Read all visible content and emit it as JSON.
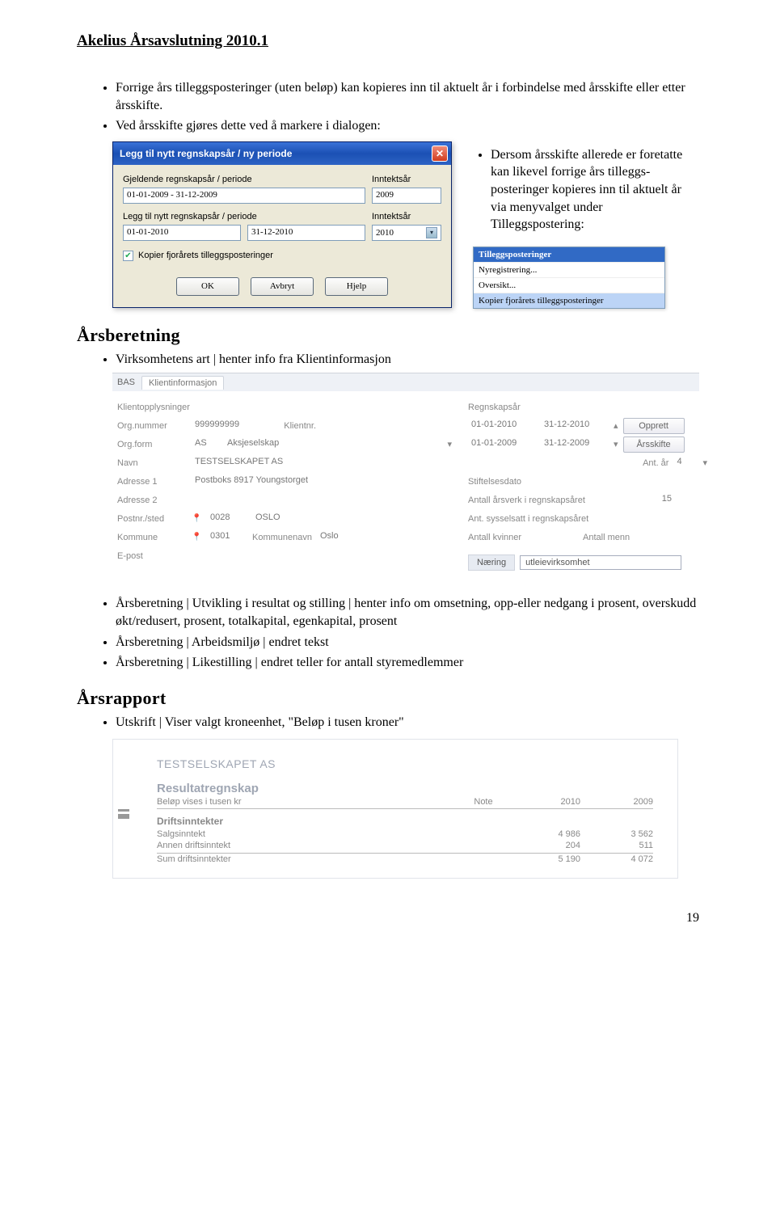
{
  "document_title": "Akelius Årsavslutning 2010.1",
  "page_number": "19",
  "intro_bullets": [
    "Forrige års tilleggsposteringer (uten beløp) kan kopieres inn til aktuelt år i forbindelse med årsskifte eller etter årsskifte.",
    "Ved årsskifte gjøres dette ved å markere i dialogen:"
  ],
  "dialog": {
    "title": "Legg til nytt regnskapsår / ny periode",
    "field1_label": "Gjeldende regnskapsår / periode",
    "field1_value": "01-01-2009 - 31-12-2009",
    "year1_label": "Inntektsår",
    "year1_value": "2009",
    "field2_label": "Legg til nytt regnskapsår / periode",
    "from_value": "01-01-2010",
    "to_value": "31-12-2010",
    "year2_label": "Inntektsår",
    "year2_value": "2010",
    "checkbox_label": "Kopier fjorårets tilleggsposteringer",
    "btn_ok": "OK",
    "btn_cancel": "Avbryt",
    "btn_help": "Hjelp"
  },
  "dialog_side_bullet": "Dersom årsskifte allerede er foretatte kan likevel forrige års tilleggs-posteringer kopieres inn til aktuelt år via menyvalget under Tilleggspostering:",
  "menu": {
    "header": "Tilleggsposteringer",
    "item1": "Nyregistrering...",
    "item2": "Oversikt...",
    "item3": "Kopier fjorårets tilleggsposteringer"
  },
  "sections": {
    "aarsberetning": "Årsberetning",
    "aarsrapport": "Årsrapport"
  },
  "aarsberetning_first_bullet": "Virksomhetens art | henter info fra Klientinformasjon",
  "aarsberetning_bullets": [
    "Årsberetning | Utvikling i resultat og stilling | henter info om omsetning, opp-eller nedgang i prosent, overskudd økt/redusert, prosent, totalkapital, egenkapital, prosent",
    "Årsberetning | Arbeidsmiljø | endret tekst",
    "Årsberetning | Likestilling | endret teller for antall styremedlemmer"
  ],
  "aarsrapport_bullet": "Utskrift | Viser valgt kroneenhet, \"Beløp i tusen kroner\"",
  "client": {
    "bas": "BAS",
    "tab": "Klientinformasjon",
    "heading": "Klientopplysninger",
    "lbl_orgnr": "Org.nummer",
    "val_orgnr": "999999999",
    "lbl_klientnr": "Klientnr.",
    "val_klientnr": "",
    "lbl_orgform": "Org.form",
    "val_orgform_code": "AS",
    "val_orgform_name": "Aksjeselskap",
    "lbl_navn": "Navn",
    "val_navn": "TESTSELSKAPET AS",
    "lbl_adr1": "Adresse 1",
    "val_adr1": "Postboks 8917 Youngstorget",
    "lbl_adr2": "Adresse 2",
    "val_adr2": "",
    "lbl_postnr": "Postnr./sted",
    "val_postnr": "0028",
    "val_sted": "OSLO",
    "lbl_kommune": "Kommune",
    "val_kommune": "0301",
    "lbl_knavn": "Kommunenavn",
    "val_knavn": "Oslo",
    "lbl_epost": "E-post",
    "val_epost": "",
    "right_heading": "Regnskapsår",
    "date1a": "01-01-2010",
    "date1b": "31-12-2010",
    "date2a": "01-01-2009",
    "date2b": "31-12-2009",
    "btn_opprett": "Opprett",
    "btn_arsskifte": "Årsskifte",
    "lbl_antar": "Ant. år",
    "val_antar": "4",
    "lbl_stift": "Stiftelsesdato",
    "lbl_arsverk": "Antall årsverk i regnskapsåret",
    "val_arsverk": "15",
    "lbl_syssel": "Ant. sysselsatt i regnskapsåret",
    "lbl_kvinner": "Antall kvinner",
    "lbl_menn": "Antall menn",
    "lbl_naering": "Næring",
    "val_naering": "utleievirksomhet"
  },
  "report": {
    "company": "TESTSELSKAPET AS",
    "title": "Resultatregnskap",
    "subtitle": "Beløp vises i tusen kr",
    "col_note": "Note",
    "col_y1": "2010",
    "col_y2": "2009",
    "group": "Driftsinntekter",
    "rows": [
      {
        "label": "Salgsinntekt",
        "y1": "4 986",
        "y2": "3 562"
      },
      {
        "label": "Annen driftsinntekt",
        "y1": "204",
        "y2": "511"
      }
    ],
    "sum_label": "Sum driftsinntekter",
    "sum_y1": "5 190",
    "sum_y2": "4 072"
  }
}
